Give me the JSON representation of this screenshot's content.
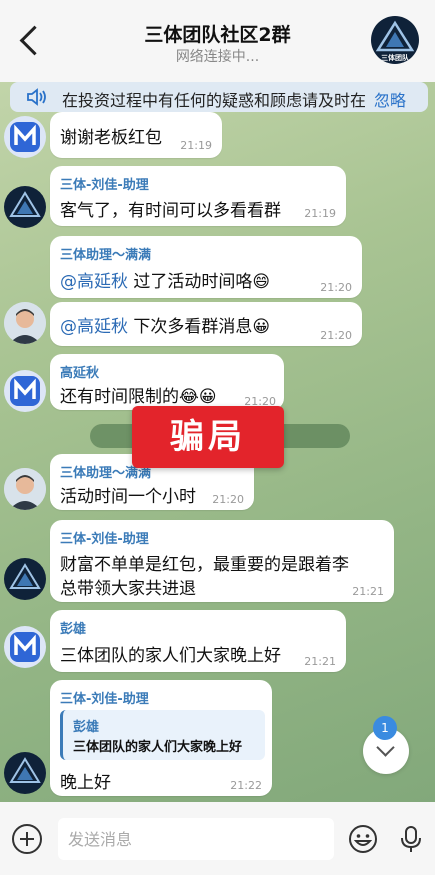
{
  "header": {
    "title": "三体团队社区2群",
    "subtitle": "网络连接中...",
    "group_avatar_text": "三体团队"
  },
  "announcement": {
    "text": "在投资过程中有任何的疑惑和顾虑请及时在",
    "link": "忽略"
  },
  "messages": [
    {
      "text": "谢谢老板红包",
      "time": "21:19"
    },
    {
      "sender": "三体-刘佳-助理",
      "text": "客气了，有时间可以多看看群",
      "time": "21:19"
    },
    {
      "sender": "三体助理～满满",
      "mention": "@高延秋",
      "text": " 过了活动时间咯😄",
      "time": "21:20"
    },
    {
      "mention": "@高延秋",
      "text": " 下次多看群消息😀",
      "time": "21:20"
    },
    {
      "sender": "高延秋",
      "text": "还有时间限制的😂😀",
      "time": "21:20"
    },
    {
      "sender": "三体助理～满满",
      "text": "活动时间一个小时",
      "time": "21:20"
    },
    {
      "sender": "三体-刘佳-助理",
      "text_line1": "财富不单单是红包，最重要的是跟着李",
      "text_line2": "总带领大家共进退",
      "time": "21:21"
    },
    {
      "sender": "彭雄",
      "text": "三体团队的家人们大家晚上好",
      "time": "21:21"
    },
    {
      "sender": "三体-刘佳-助理",
      "quote_name": "彭雄",
      "quote_text": "三体团队的家人们大家晚上好",
      "text": "晚上好",
      "time": "21:22"
    }
  ],
  "system_notice": "\"彭雄\"                                        入了群聊",
  "overlay_label": "骗局",
  "scroll_badge": "1",
  "input": {
    "placeholder": "发送消息"
  },
  "colors": {
    "accent": "#3b7bb8",
    "stamp": "#e3242b",
    "badge": "#3a8be0"
  },
  "icons": [
    "back-arrow-icon",
    "speaker-icon",
    "plus-icon",
    "emoji-icon",
    "mic-icon",
    "chevron-down-icon",
    "m-logo-icon",
    "triangle-logo-icon"
  ]
}
